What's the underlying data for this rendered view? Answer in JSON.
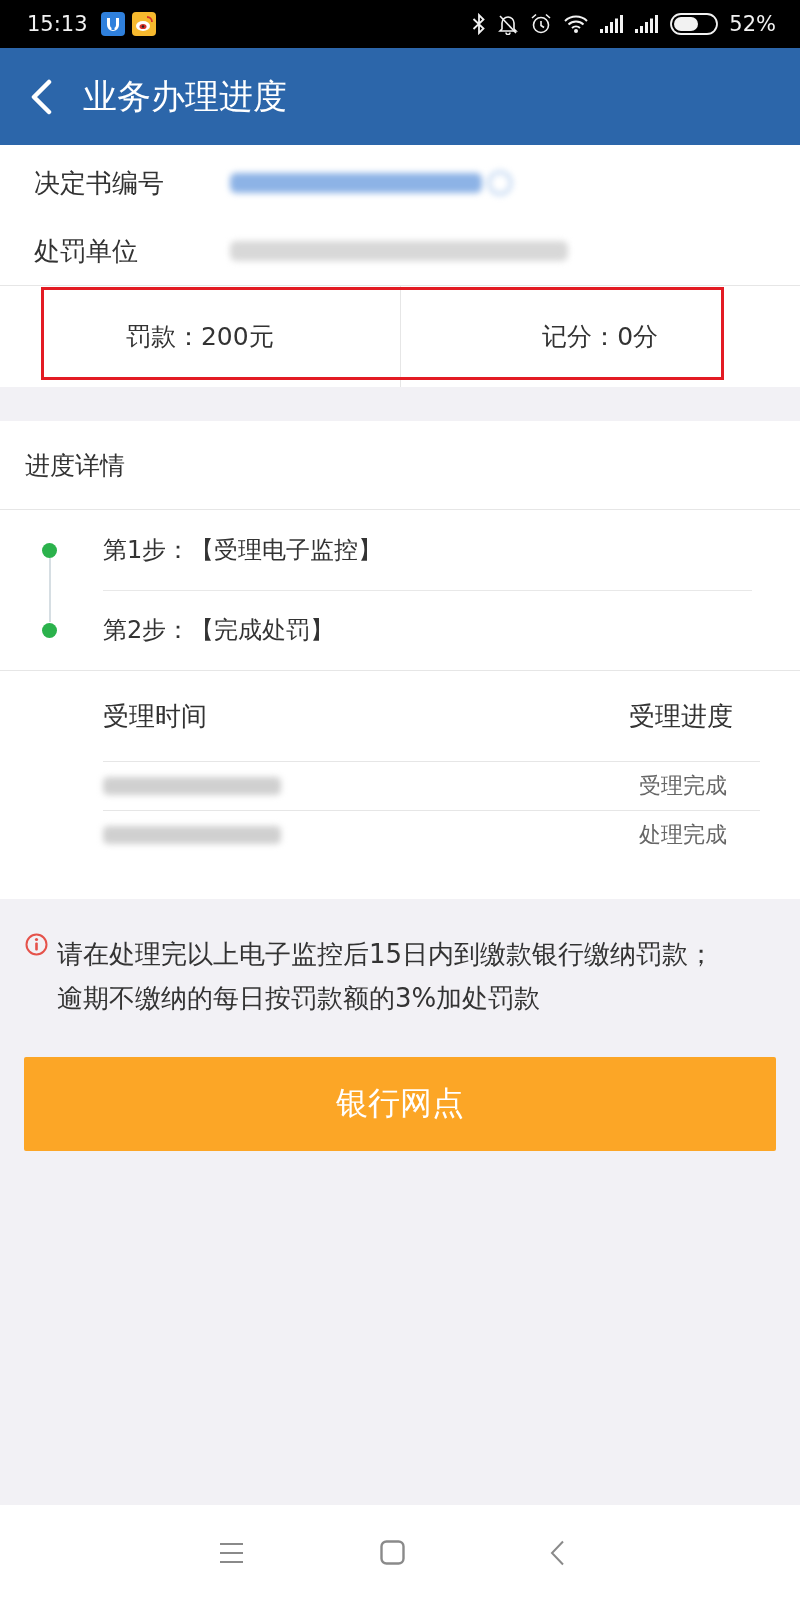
{
  "status_bar": {
    "time": "15:13",
    "battery": "52%"
  },
  "header": {
    "title": "业务办理进度"
  },
  "info_rows": [
    {
      "label": "决定书编号",
      "kind": "link"
    },
    {
      "label": "处罚单位",
      "kind": "text"
    }
  ],
  "summary": {
    "highlighted": true,
    "items": [
      {
        "text": "罚款：200元"
      },
      {
        "text": "记分：0分"
      }
    ]
  },
  "progress": {
    "title": "进度详情",
    "steps": [
      {
        "text": "第1步：【受理电子监控】",
        "done": true
      },
      {
        "text": "第2步：【完成处罚】",
        "done": true
      }
    ]
  },
  "records": {
    "columns": [
      "受理时间",
      "受理进度"
    ],
    "rows": [
      {
        "status": "受理完成"
      },
      {
        "status": "处理完成"
      }
    ]
  },
  "notice": {
    "text": "请在处理完以上电子监控后15日内到缴款银行缴纳罚款；逾期不缴纳的每日按罚款额的3%加处罚款"
  },
  "button": {
    "label": "银行网点"
  }
}
